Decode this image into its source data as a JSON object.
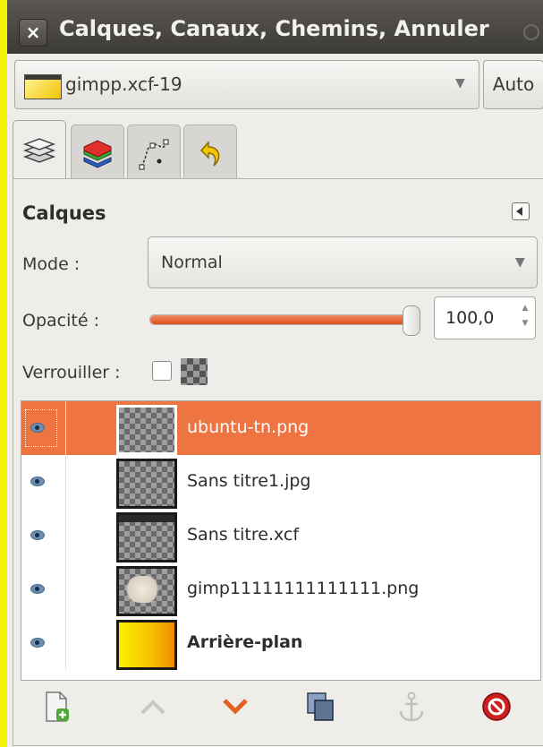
{
  "window": {
    "title": "Calques, Canaux, Chemins, Annuler",
    "close_label": "×"
  },
  "image_selector": {
    "value": "gimpp.xcf-19",
    "auto_label": "Auto"
  },
  "tabs": [
    {
      "name": "layers",
      "active": true
    },
    {
      "name": "channels",
      "active": false
    },
    {
      "name": "paths",
      "active": false
    },
    {
      "name": "undo-history",
      "active": false
    }
  ],
  "layers_panel": {
    "title": "Calques",
    "mode_label": "Mode :",
    "mode_value": "Normal",
    "opacity_label": "Opacité :",
    "opacity_value": "100,0",
    "opacity_fraction": 1.0,
    "lock_label": "Verrouiller :",
    "lock_checked": false
  },
  "layers": [
    {
      "name": "ubuntu-tn.png",
      "visible": true,
      "selected": true,
      "bold": false
    },
    {
      "name": "Sans titre1.jpg",
      "visible": true,
      "selected": false,
      "bold": false
    },
    {
      "name": "Sans titre.xcf",
      "visible": true,
      "selected": false,
      "bold": false
    },
    {
      "name": "gimp11111111111111.png",
      "visible": true,
      "selected": false,
      "bold": false
    },
    {
      "name": "Arrière-plan",
      "visible": true,
      "selected": false,
      "bold": true
    }
  ],
  "colors": {
    "selection": "#ee7442",
    "background": "#f6f205",
    "titlebar": "#4a4743"
  },
  "toolbar_icons": [
    "new-layer-icon",
    "raise-icon",
    "lower-icon",
    "duplicate-icon",
    "anchor-icon",
    "delete-icon"
  ]
}
